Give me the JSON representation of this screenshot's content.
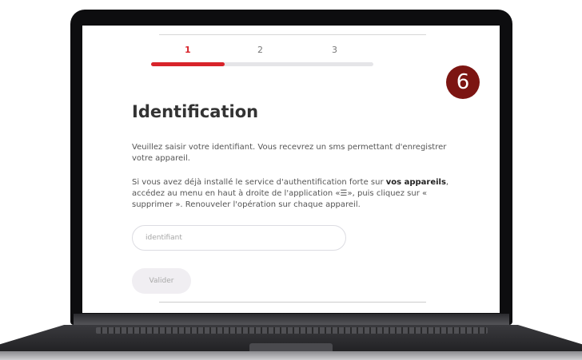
{
  "stepper": {
    "steps": [
      "1",
      "2",
      "3"
    ],
    "active_step": 1,
    "progress": 0.33
  },
  "marker": {
    "label": "6"
  },
  "form": {
    "title": "Identification",
    "intro": "Veuillez saisir votre identifiant. Vous recevrez un sms permettant d'enregistrer votre appareil.",
    "note_part1": "Si vous avez déjà installé le service d'authentification forte sur ",
    "note_bold": "vos appareils",
    "note_part2": ", accédez au menu en haut à droite de l'application «☰», puis cliquez sur « supprimer ». Renouveler l'opération sur chaque appareil.",
    "input": {
      "placeholder": "identifiant",
      "value": ""
    },
    "submit_label": "Valider"
  },
  "colors": {
    "accent": "#d8232a",
    "marker": "#7c1512",
    "track": "#e5e5e8",
    "bezel": "#0d0d0f"
  }
}
